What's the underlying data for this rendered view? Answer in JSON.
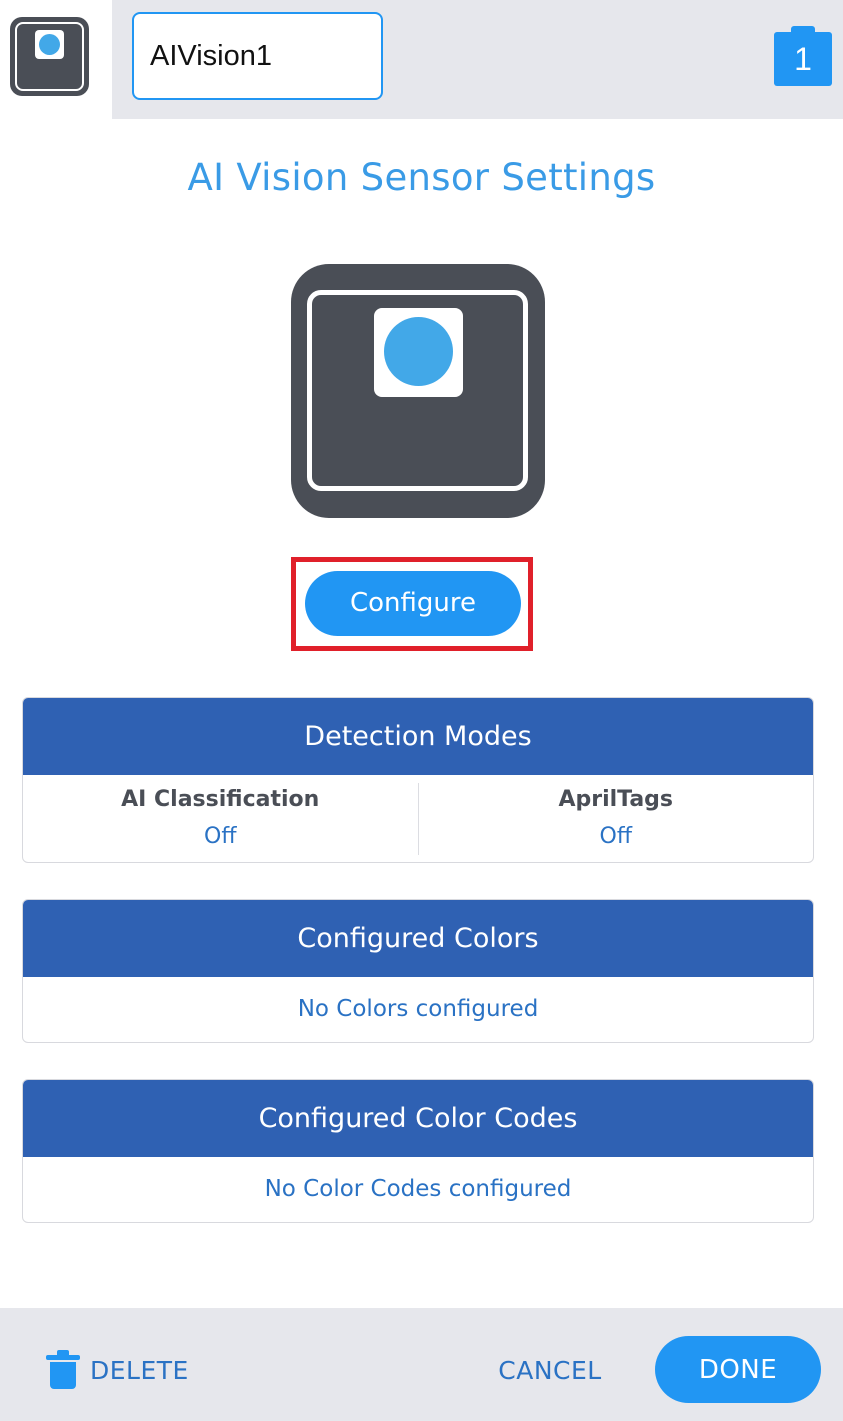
{
  "header": {
    "device_name_value": "AIVision1",
    "port_number": "1"
  },
  "page_title": "AI Vision Sensor Settings",
  "configure_label": "Configure",
  "detection_modes": {
    "title": "Detection Modes",
    "modes": [
      {
        "name": "AI Classification",
        "value": "Off"
      },
      {
        "name": "AprilTags",
        "value": "Off"
      }
    ]
  },
  "configured_colors": {
    "title": "Configured Colors",
    "empty_text": "No Colors configured"
  },
  "configured_color_codes": {
    "title": "Configured Color Codes",
    "empty_text": "No Color Codes configured"
  },
  "footer": {
    "delete_label": "DELETE",
    "cancel_label": "CANCEL",
    "done_label": "DONE"
  },
  "colors": {
    "accent": "#2196f3",
    "title_blue": "#3a9be6",
    "card_header": "#2f61b3",
    "device_body": "#4a4e56",
    "lens": "#42a8e8",
    "highlight": "#e0202a"
  }
}
